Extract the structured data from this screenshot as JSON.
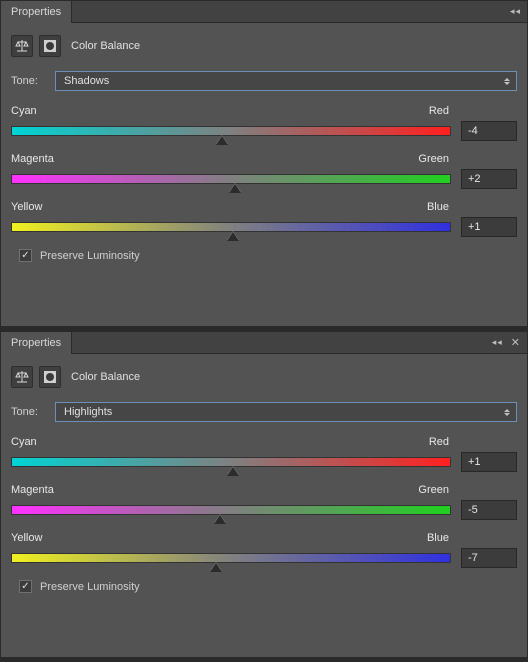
{
  "panels": [
    {
      "tab_label": "Properties",
      "show_close": false,
      "adjustment_title": "Color Balance",
      "tone_label": "Tone:",
      "tone_value": "Shadows",
      "sliders": [
        {
          "left": "Cyan",
          "right": "Red",
          "value": "-4",
          "pos": 48
        },
        {
          "left": "Magenta",
          "right": "Green",
          "value": "+2",
          "pos": 51
        },
        {
          "left": "Yellow",
          "right": "Blue",
          "value": "+1",
          "pos": 50.5
        }
      ],
      "preserve_label": "Preserve Luminosity",
      "preserve_checked": true
    },
    {
      "tab_label": "Properties",
      "show_close": true,
      "adjustment_title": "Color Balance",
      "tone_label": "Tone:",
      "tone_value": "Highlights",
      "sliders": [
        {
          "left": "Cyan",
          "right": "Red",
          "value": "+1",
          "pos": 50.5
        },
        {
          "left": "Magenta",
          "right": "Green",
          "value": "-5",
          "pos": 47.5
        },
        {
          "left": "Yellow",
          "right": "Blue",
          "value": "-7",
          "pos": 46.5
        }
      ],
      "preserve_label": "Preserve Luminosity",
      "preserve_checked": true
    }
  ],
  "collapse_glyph": "◂◂"
}
